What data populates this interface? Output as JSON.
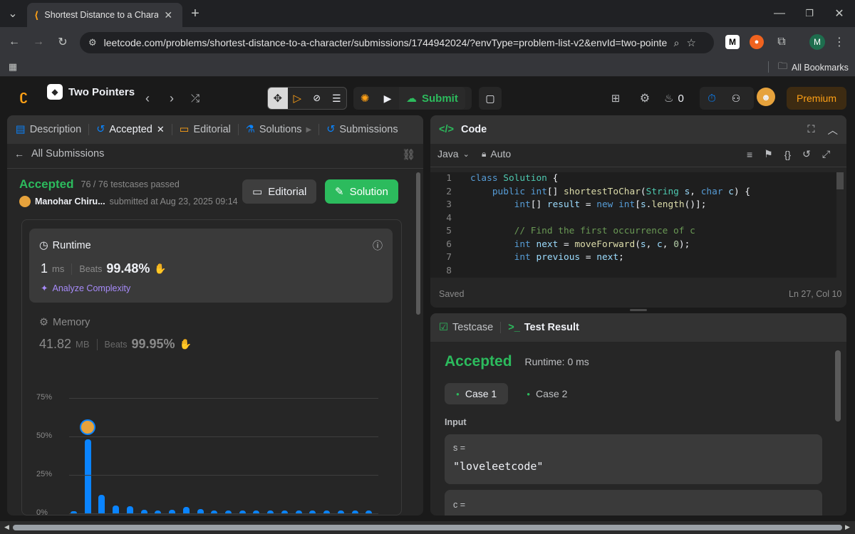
{
  "browser": {
    "tab_title": "Shortest Distance to a Characte",
    "url": "leetcode.com/problems/shortest-distance-to-a-character/submissions/1744942024/?envType=problem-list-v2&envId=two-pointers",
    "all_bookmarks": "All Bookmarks",
    "profile_initial": "M",
    "ext_m": "M"
  },
  "nav": {
    "list_title": "Two Pointers",
    "submit_label": "Submit",
    "streak": "0",
    "premium_label": "Premium"
  },
  "left": {
    "tabs": [
      "Description",
      "Accepted",
      "Editorial",
      "Solutions",
      "Submissions"
    ],
    "all_submissions": "All Submissions",
    "status": "Accepted",
    "testcases": "76 / 76 testcases passed",
    "user": "Manohar Chiru...",
    "submitted": "submitted at Aug 23, 2025 09:14",
    "editorial_btn": "Editorial",
    "solution_btn": "Solution",
    "runtime": {
      "label": "Runtime",
      "value": "1",
      "unit": "ms",
      "beats_label": "Beats",
      "beats": "99.48%",
      "analyze": "Analyze Complexity"
    },
    "memory": {
      "label": "Memory",
      "value": "41.82",
      "unit": "MB",
      "beats_label": "Beats",
      "beats": "99.95%"
    }
  },
  "chart_data": {
    "type": "bar",
    "ytick_labels": [
      "75%",
      "50%",
      "25%",
      "0%"
    ],
    "ylim": [
      0,
      75
    ],
    "values": [
      1.5,
      48,
      12,
      5,
      4.5,
      2.5,
      2,
      2.5,
      4,
      3,
      2,
      2,
      2,
      2,
      2,
      2,
      2,
      2,
      2,
      2,
      2,
      2
    ],
    "highlight_index": 1
  },
  "code": {
    "title": "Code",
    "language": "Java",
    "mode": "Auto",
    "saved": "Saved",
    "cursor": "Ln 27, Col 10",
    "lines": [
      "class Solution {",
      "    public int[] shortestToChar(String s, char c) {",
      "        int[] result = new int[s.length()];",
      "",
      "        // Find the first occurrence of c",
      "        int next = moveForward(s, c, 0);",
      "        int previous = next;",
      ""
    ]
  },
  "result": {
    "tab_testcase": "Testcase",
    "tab_result": "Test Result",
    "status": "Accepted",
    "runtime": "Runtime: 0 ms",
    "cases": [
      "Case 1",
      "Case 2"
    ],
    "input_label": "Input",
    "s_label": "s =",
    "s_value": "\"loveleetcode\"",
    "c_label": "c ="
  }
}
